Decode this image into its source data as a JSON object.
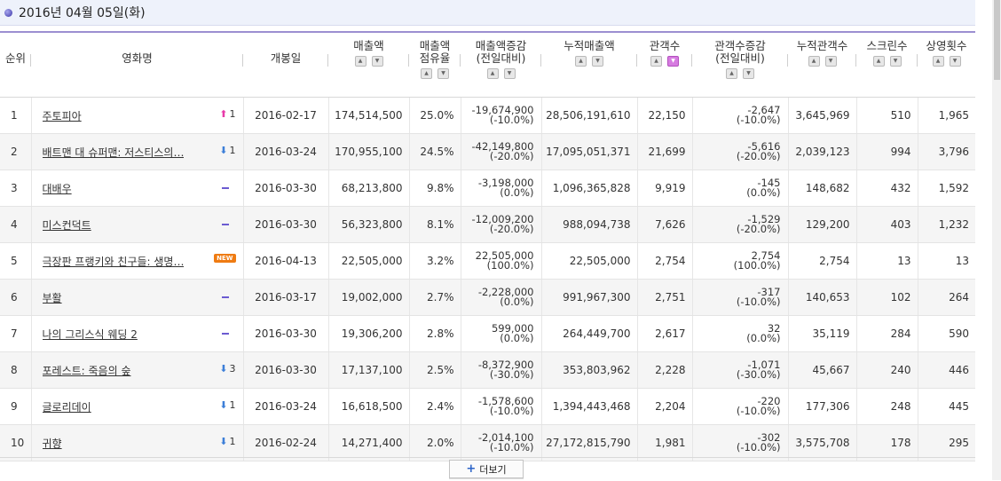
{
  "header": {
    "date": "2016년 04월 05일(화)"
  },
  "columns": [
    {
      "label": "순위",
      "sortable": false
    },
    {
      "label": "영화명",
      "sortable": false
    },
    {
      "label": "개봉일",
      "sortable": false
    },
    {
      "label": "매출액",
      "sortable": true
    },
    {
      "label": "매출액\n점유율",
      "sortable": true
    },
    {
      "label": "매출액증감\n(전일대비)",
      "sortable": true
    },
    {
      "label": "누적매출액",
      "sortable": true
    },
    {
      "label": "관객수",
      "sortable": true,
      "active": true
    },
    {
      "label": "관객수증감\n(전일대비)",
      "sortable": true
    },
    {
      "label": "누적관객수",
      "sortable": true
    },
    {
      "label": "스크린수",
      "sortable": true
    },
    {
      "label": "상영횟수",
      "sortable": true
    }
  ],
  "rows": [
    {
      "rank": "1",
      "title": "주토피아",
      "change_type": "up",
      "change_val": "1",
      "release": "2016-02-17",
      "sales": "174,514,500",
      "share": "25.0%",
      "sales_diff": "-19,674,900",
      "sales_diff_pct": "(-10.0%)",
      "cum_sales": "28,506,191,610",
      "audience": "22,150",
      "aud_diff": "-2,647",
      "aud_diff_pct": "(-10.0%)",
      "cum_aud": "3,645,969",
      "screens": "510",
      "shows": "1,965"
    },
    {
      "rank": "2",
      "title": "배트맨 대 슈퍼맨: 저스티스의…",
      "change_type": "down",
      "change_val": "1",
      "release": "2016-03-24",
      "sales": "170,955,100",
      "share": "24.5%",
      "sales_diff": "-42,149,800",
      "sales_diff_pct": "(-20.0%)",
      "cum_sales": "17,095,051,371",
      "audience": "21,699",
      "aud_diff": "-5,616",
      "aud_diff_pct": "(-20.0%)",
      "cum_aud": "2,039,123",
      "screens": "994",
      "shows": "3,796"
    },
    {
      "rank": "3",
      "title": "대배우",
      "change_type": "same",
      "change_val": "",
      "release": "2016-03-30",
      "sales": "68,213,800",
      "share": "9.8%",
      "sales_diff": "-3,198,000",
      "sales_diff_pct": "(0.0%)",
      "cum_sales": "1,096,365,828",
      "audience": "9,919",
      "aud_diff": "-145",
      "aud_diff_pct": "(0.0%)",
      "cum_aud": "148,682",
      "screens": "432",
      "shows": "1,592"
    },
    {
      "rank": "4",
      "title": "미스컨덕트",
      "change_type": "same",
      "change_val": "",
      "release": "2016-03-30",
      "sales": "56,323,800",
      "share": "8.1%",
      "sales_diff": "-12,009,200",
      "sales_diff_pct": "(-20.0%)",
      "cum_sales": "988,094,738",
      "audience": "7,626",
      "aud_diff": "-1,529",
      "aud_diff_pct": "(-20.0%)",
      "cum_aud": "129,200",
      "screens": "403",
      "shows": "1,232"
    },
    {
      "rank": "5",
      "title": "극장판 프랭키와 친구들: 생명…",
      "change_type": "new",
      "change_val": "NEW",
      "release": "2016-04-13",
      "sales": "22,505,000",
      "share": "3.2%",
      "sales_diff": "22,505,000",
      "sales_diff_pct": "(100.0%)",
      "cum_sales": "22,505,000",
      "audience": "2,754",
      "aud_diff": "2,754",
      "aud_diff_pct": "(100.0%)",
      "cum_aud": "2,754",
      "screens": "13",
      "shows": "13"
    },
    {
      "rank": "6",
      "title": "부활",
      "change_type": "same",
      "change_val": "",
      "release": "2016-03-17",
      "sales": "19,002,000",
      "share": "2.7%",
      "sales_diff": "-2,228,000",
      "sales_diff_pct": "(0.0%)",
      "cum_sales": "991,967,300",
      "audience": "2,751",
      "aud_diff": "-317",
      "aud_diff_pct": "(-10.0%)",
      "cum_aud": "140,653",
      "screens": "102",
      "shows": "264"
    },
    {
      "rank": "7",
      "title": "나의 그리스식 웨딩 2",
      "change_type": "same",
      "change_val": "",
      "release": "2016-03-30",
      "sales": "19,306,200",
      "share": "2.8%",
      "sales_diff": "599,000",
      "sales_diff_pct": "(0.0%)",
      "cum_sales": "264,449,700",
      "audience": "2,617",
      "aud_diff": "32",
      "aud_diff_pct": "(0.0%)",
      "cum_aud": "35,119",
      "screens": "284",
      "shows": "590"
    },
    {
      "rank": "8",
      "title": "포레스트: 죽음의 숲",
      "change_type": "down",
      "change_val": "3",
      "release": "2016-03-30",
      "sales": "17,137,100",
      "share": "2.5%",
      "sales_diff": "-8,372,900",
      "sales_diff_pct": "(-30.0%)",
      "cum_sales": "353,803,962",
      "audience": "2,228",
      "aud_diff": "-1,071",
      "aud_diff_pct": "(-30.0%)",
      "cum_aud": "45,667",
      "screens": "240",
      "shows": "446"
    },
    {
      "rank": "9",
      "title": "글로리데이",
      "change_type": "down",
      "change_val": "1",
      "release": "2016-03-24",
      "sales": "16,618,500",
      "share": "2.4%",
      "sales_diff": "-1,578,600",
      "sales_diff_pct": "(-10.0%)",
      "cum_sales": "1,394,443,468",
      "audience": "2,204",
      "aud_diff": "-220",
      "aud_diff_pct": "(-10.0%)",
      "cum_aud": "177,306",
      "screens": "248",
      "shows": "445"
    },
    {
      "rank": "10",
      "title": "귀향",
      "change_type": "down",
      "change_val": "1",
      "release": "2016-02-24",
      "sales": "14,271,400",
      "share": "2.0%",
      "sales_diff": "-2,014,100",
      "sales_diff_pct": "(-10.0%)",
      "cum_sales": "27,172,815,790",
      "audience": "1,981",
      "aud_diff": "-302",
      "aud_diff_pct": "(-10.0%)",
      "cum_aud": "3,575,708",
      "screens": "178",
      "shows": "295"
    }
  ],
  "more_button": {
    "label": "더보기"
  }
}
